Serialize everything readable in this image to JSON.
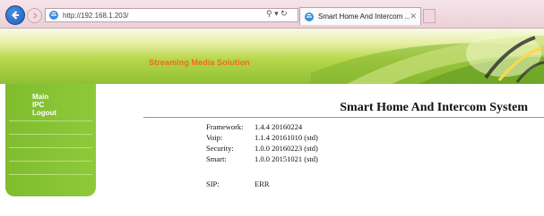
{
  "browser": {
    "url": "http://192.168.1.203/",
    "search_glyph": "⚲ ▾ ↻",
    "tab_title": "Smart Home And Intercom ...",
    "tab_close": "✕"
  },
  "banner": {
    "title": "Streaming Media Solution"
  },
  "sidebar": {
    "items": [
      {
        "label": "Main"
      },
      {
        "label": "IPC"
      },
      {
        "label": "Logout"
      }
    ]
  },
  "main": {
    "title": "Smart Home And Intercom System",
    "versions": [
      {
        "key": "Framework:",
        "value": "1.4.4 20160224"
      },
      {
        "key": "Voip:",
        "value": "1.1.4 20161010 (std)"
      },
      {
        "key": "Security:",
        "value": "1.0.0 20160223 (std)"
      },
      {
        "key": "Smart:",
        "value": "1.0.0 20151021 (std)"
      }
    ],
    "sip": {
      "key": "SIP:",
      "value": "ERR"
    }
  },
  "colors": {
    "sidebar_green": "#8ec93a",
    "banner_title_orange": "#f26a1b",
    "chrome_pink": "#ecd0d8"
  }
}
